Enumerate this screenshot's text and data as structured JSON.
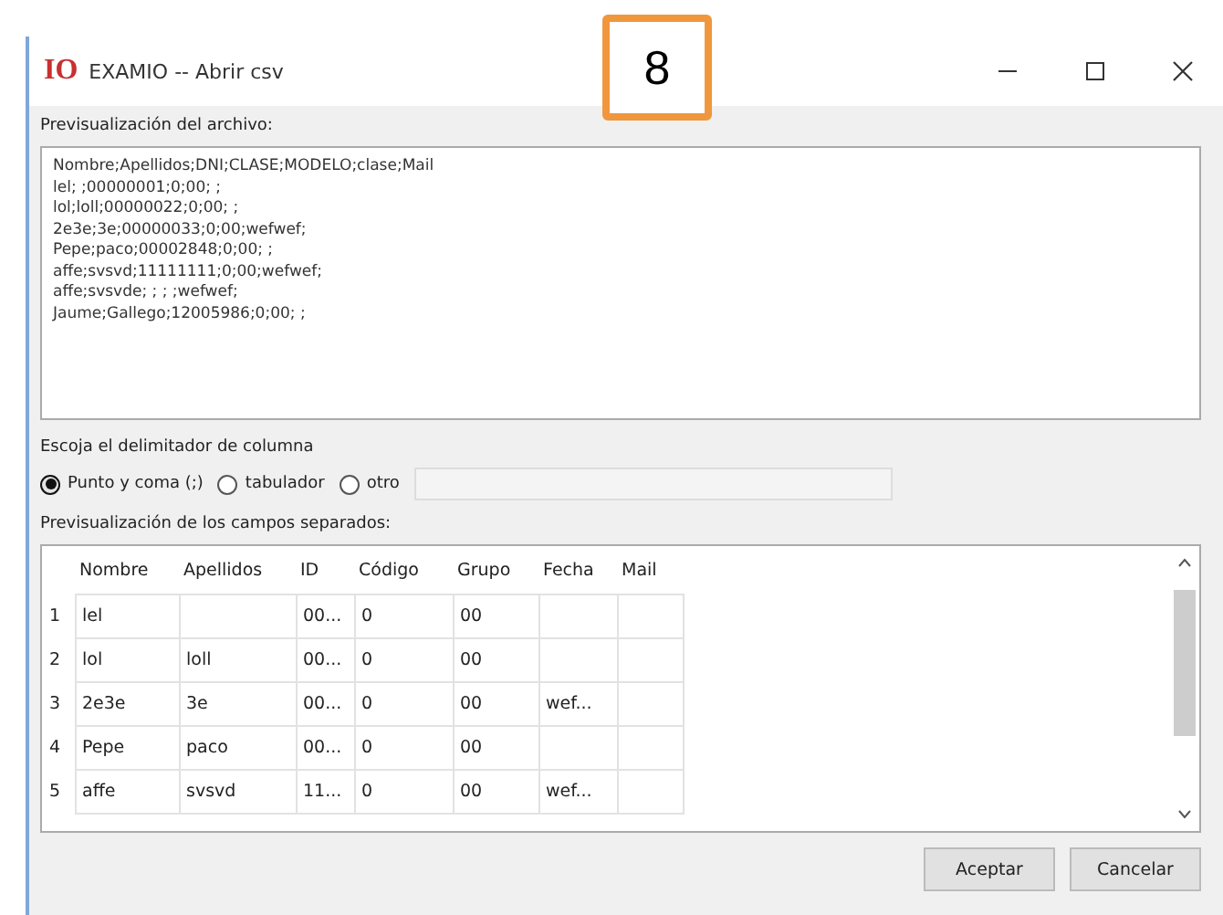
{
  "window": {
    "logo": "IO",
    "title": "EXAMIO  -- Abrir csv"
  },
  "callout_badge": "8",
  "file_preview": {
    "label": "Previsualización del archivo:",
    "lines": [
      "Nombre;Apellidos;DNI;CLASE;MODELO;clase;Mail",
      "lel; ;00000001;0;00; ;",
      "lol;loll;00000022;0;00; ;",
      "2e3e;3e;00000033;0;00;wefwef;",
      "Pepe;paco;00002848;0;00; ;",
      "affe;svsvd;11111111;0;00;wefwef;",
      "affe;svsvde; ; ; ;wefwef;",
      "Jaume;Gallego;12005986;0;00; ;"
    ]
  },
  "delimiter": {
    "label": "Escoja el delimitador de columna",
    "options": [
      {
        "label": "Punto y coma (;)",
        "selected": true
      },
      {
        "label": "tabulador",
        "selected": false
      },
      {
        "label": "otro",
        "selected": false
      }
    ]
  },
  "fields_preview": {
    "label": "Previsualización de los campos separados:",
    "columns": [
      "Nombre",
      "Apellidos",
      "ID",
      "Código",
      "Grupo",
      "Fecha",
      "Mail"
    ],
    "rows": [
      {
        "number": "1",
        "cells": [
          "lel",
          "",
          "00...",
          "0",
          "00",
          "",
          ""
        ]
      },
      {
        "number": "2",
        "cells": [
          "lol",
          "loll",
          "00...",
          "0",
          "00",
          "",
          ""
        ]
      },
      {
        "number": "3",
        "cells": [
          "2e3e",
          "3e",
          "00...",
          "0",
          "00",
          "wef...",
          ""
        ]
      },
      {
        "number": "4",
        "cells": [
          "Pepe",
          "paco",
          "00...",
          "0",
          "00",
          "",
          ""
        ]
      },
      {
        "number": "5",
        "cells": [
          "affe",
          "svsvd",
          "11...",
          "0",
          "00",
          "wef...",
          ""
        ]
      }
    ]
  },
  "buttons": [
    "Aceptar",
    "Cancelar"
  ]
}
